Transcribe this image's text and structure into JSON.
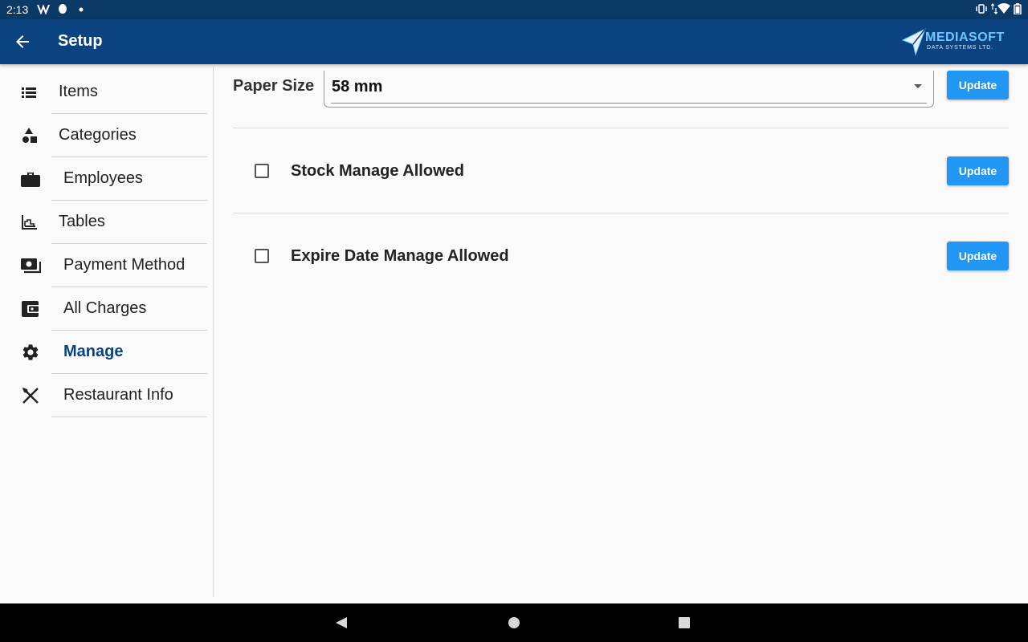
{
  "status_bar": {
    "time": "2:13",
    "icons": [
      "network-icon",
      "sync-icon",
      "dot-icon",
      "vibrate-icon",
      "data-arrows-icon",
      "wifi-icon",
      "battery-icon"
    ]
  },
  "app_bar": {
    "title": "Setup",
    "back_icon": "arrow-back-icon",
    "logo_brand": "MEDIASOFT",
    "logo_subtitle": "DATA SYSTEMS LTD."
  },
  "sidebar": {
    "items": [
      {
        "label": "Items",
        "icon": "list-icon"
      },
      {
        "label": "Categories",
        "icon": "category-shapes-icon"
      },
      {
        "label": "Employees",
        "icon": "briefcase-icon"
      },
      {
        "label": "Tables",
        "icon": "table-chart-icon"
      },
      {
        "label": "Payment Method",
        "icon": "payments-icon"
      },
      {
        "label": "All Charges",
        "icon": "wallet-icon"
      },
      {
        "label": "Manage",
        "icon": "gear-icon"
      },
      {
        "label": "Restaurant Info",
        "icon": "cutlery-icon"
      }
    ],
    "active_item": "Manage"
  },
  "main": {
    "paper_size": {
      "label": "Paper Size",
      "value": "58 mm",
      "button": "Update"
    },
    "settings": [
      {
        "label": "Stock Manage Allowed",
        "checked": false,
        "button": "Update"
      },
      {
        "label": "Expire Date Manage Allowed",
        "checked": false,
        "button": "Update"
      }
    ]
  },
  "colors": {
    "status_bar": "#0b3a66",
    "app_bar": "#0b4380",
    "accent": "#2196f3",
    "active_nav": "#0b4380"
  }
}
